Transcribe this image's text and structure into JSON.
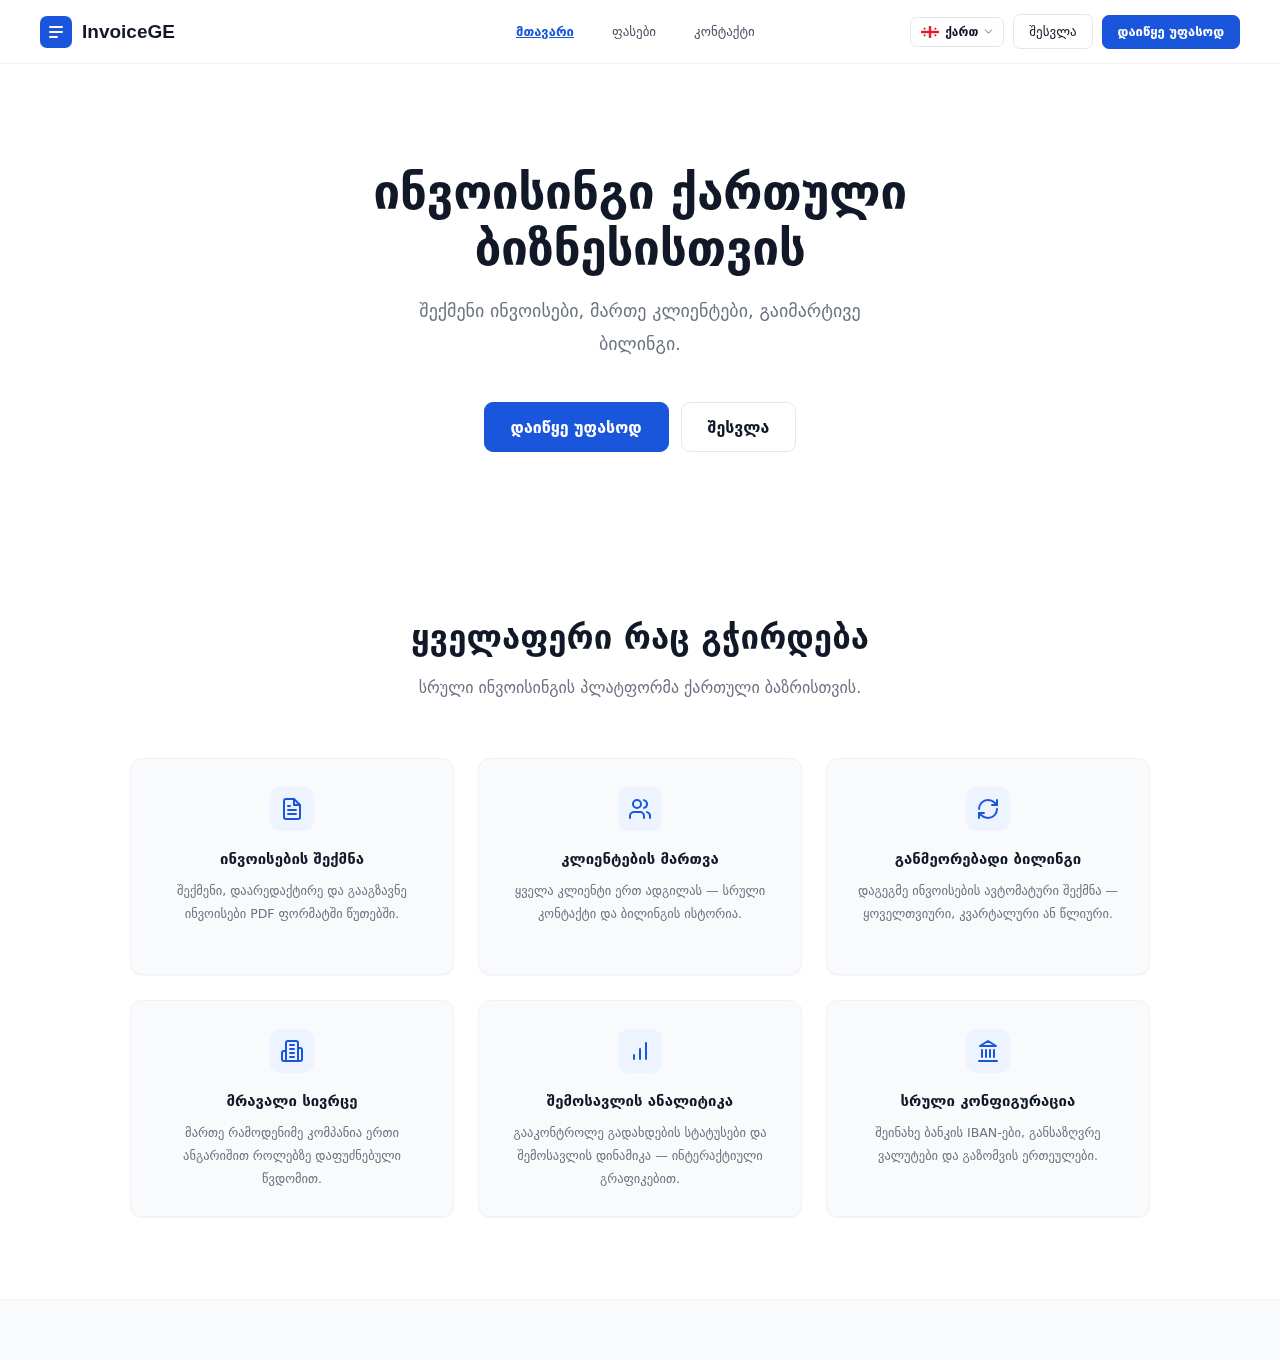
{
  "header": {
    "logo": "InvoiceGE",
    "nav": [
      {
        "label": "მთავარი",
        "selected": true
      },
      {
        "label": "ფასები",
        "selected": false
      },
      {
        "label": "კონტაქტი",
        "selected": false
      }
    ],
    "language": "ქართ",
    "login": "შესვლა",
    "signup": "დაიწყე უფასოდ"
  },
  "hero": {
    "title": "ინვოისინგი ქართული ბიზნესისთვის",
    "subtitle": "შექმენი ინვოისები, მართე კლიენტები, გაიმარტივე ბილინგი.",
    "primary_button": "დაიწყე უფასოდ",
    "secondary_button": "შესვლა"
  },
  "features": {
    "title": "ყველაფერი რაც გჭირდება",
    "subtitle": "სრული ინვოისინგის პლატფორმა ქართული ბაზრისთვის.",
    "cards": [
      {
        "title": "ინვოისების შექმნა",
        "description": "შექმენი, დაარედაქტირე და გააგზავნე ინვოისები PDF ფორმატში წუთებში."
      },
      {
        "title": "კლიენტების მართვა",
        "description": "ყველა კლიენტი ერთ ადგილას — სრული კონტაქტი და ბილინგის ისტორია."
      },
      {
        "title": "განმეორებადი ბილინგი",
        "description": "დაგეგმე ინვოისების ავტომატური შექმნა — ყოველთვიური, კვარტალური ან წლიური."
      },
      {
        "title": "მრავალი სივრცე",
        "description": "მართე რამოდენიმე კომპანია ერთი ანგარიშით როლებზე დაფუძნებული წვდომით."
      },
      {
        "title": "შემოსავლის ანალიტიკა",
        "description": "გააკონტროლე გადახდების სტატუსები და შემოსავლის დინამიკა — ინტერაქტიული გრაფიკებით."
      },
      {
        "title": "სრული კონფიგურაცია",
        "description": "შეინახე ბანკის IBAN-ები, განსაზღვრე ვალუტები და გაზომვის ერთეულები."
      }
    ]
  }
}
